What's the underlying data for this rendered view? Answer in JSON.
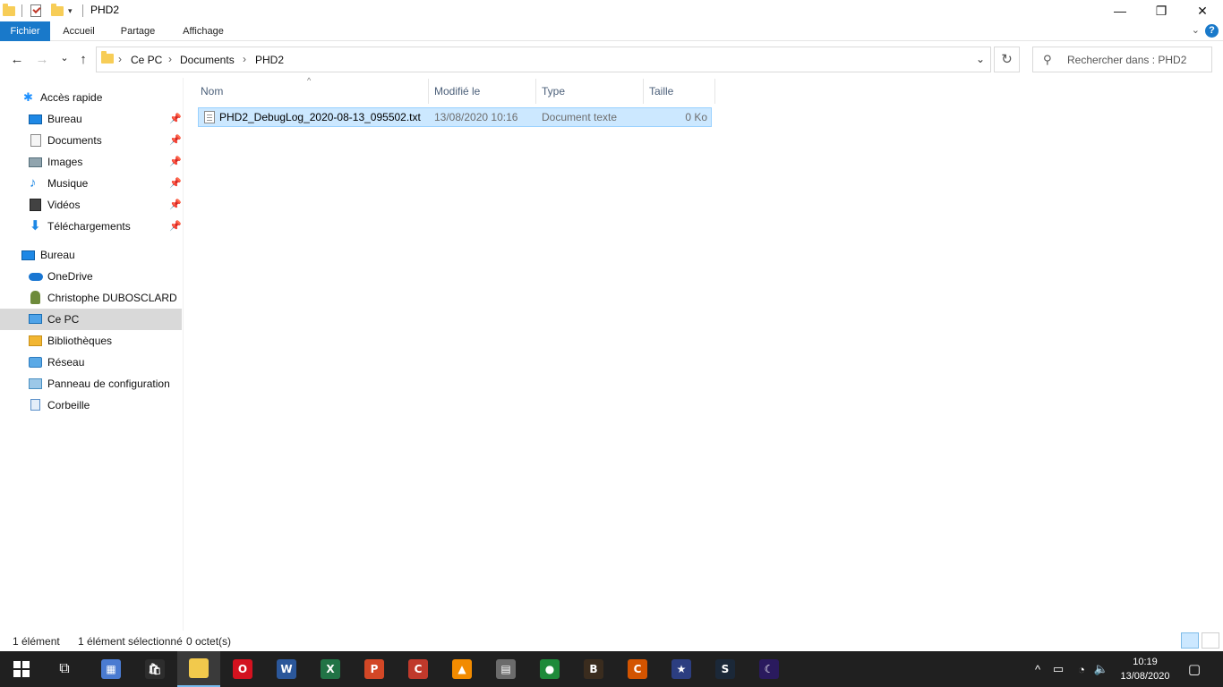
{
  "window": {
    "title": "PHD2",
    "minimize_glyph": "—",
    "maximize_glyph": "❐",
    "close_glyph": "✕"
  },
  "ribbon": {
    "tabs": [
      {
        "label": "Fichier"
      },
      {
        "label": "Accueil"
      },
      {
        "label": "Partage"
      },
      {
        "label": "Affichage"
      }
    ],
    "help_glyph": "?"
  },
  "nav": {
    "back_glyph": "←",
    "forward_glyph": "→",
    "recent_glyph": "⌄",
    "up_glyph": "↑",
    "breadcrumb": [
      "Ce PC",
      "Documents",
      "PHD2"
    ],
    "refresh_glyph": "↻",
    "search_placeholder": "Rechercher dans : PHD2"
  },
  "sidebar": {
    "quick_access": {
      "label": "Accès rapide",
      "icon": "star-icon",
      "color": "#1e90ff"
    },
    "pinned": [
      {
        "label": "Bureau",
        "icon": "desktop-icon",
        "color": "#1e88e5"
      },
      {
        "label": "Documents",
        "icon": "documents-icon",
        "color": "#9e9e9e"
      },
      {
        "label": "Images",
        "icon": "pictures-icon",
        "color": "#607d8b"
      },
      {
        "label": "Musique",
        "icon": "music-icon",
        "color": "#1e88e5"
      },
      {
        "label": "Vidéos",
        "icon": "videos-icon",
        "color": "#424242"
      },
      {
        "label": "Téléchargements",
        "icon": "download-icon",
        "color": "#1e88e5"
      }
    ],
    "tree": [
      {
        "label": "Bureau",
        "icon": "desktop-icon",
        "color": "#1e88e5"
      },
      {
        "label": "OneDrive",
        "icon": "cloud-icon",
        "color": "#1976d2"
      },
      {
        "label": "Christophe DUBOSCLARD",
        "icon": "user-icon",
        "color": "#6d8a3a"
      },
      {
        "label": "Ce PC",
        "icon": "computer-icon",
        "color": "#1e88e5",
        "selected": true
      },
      {
        "label": "Bibliothèques",
        "icon": "libraries-icon",
        "color": "#f2b632"
      },
      {
        "label": "Réseau",
        "icon": "network-icon",
        "color": "#1e88e5"
      },
      {
        "label": "Panneau de configuration",
        "icon": "control-panel-icon",
        "color": "#4a90c2"
      },
      {
        "label": "Corbeille",
        "icon": "recycle-bin-icon",
        "color": "#5a8fc9"
      }
    ]
  },
  "columns": [
    {
      "label": "Nom"
    },
    {
      "label": "Modifié le"
    },
    {
      "label": "Type"
    },
    {
      "label": "Taille"
    }
  ],
  "files": [
    {
      "name": "PHD2_DebugLog_2020-08-13_095502.txt",
      "modified": "13/08/2020 10:16",
      "type": "Document texte",
      "size": "0 Ko",
      "selected": true
    }
  ],
  "status": {
    "count": "1 élément",
    "selection": "1 élément sélectionné",
    "size": "0 octet(s)"
  },
  "taskbar": {
    "apps": [
      {
        "name": "calculator",
        "color": "#4a7bd1",
        "glyph": "▦"
      },
      {
        "name": "store",
        "color": "#2d2d2d",
        "glyph": "🛍"
      },
      {
        "name": "file-explorer",
        "color": "#f2c94c",
        "glyph": "",
        "active": true
      },
      {
        "name": "opera",
        "color": "#d3121f",
        "glyph": "O"
      },
      {
        "name": "word",
        "color": "#2b579a",
        "glyph": "W"
      },
      {
        "name": "excel",
        "color": "#217346",
        "glyph": "X"
      },
      {
        "name": "powerpoint",
        "color": "#d24726",
        "glyph": "P"
      },
      {
        "name": "ccleaner",
        "color": "#c0392b",
        "glyph": "C"
      },
      {
        "name": "vlc",
        "color": "#f28b00",
        "glyph": "▲"
      },
      {
        "name": "app-gray",
        "color": "#6b6b6b",
        "glyph": "▤"
      },
      {
        "name": "app-green",
        "color": "#1e8a3a",
        "glyph": "●"
      },
      {
        "name": "backyard-eos",
        "color": "#3a2c1e",
        "glyph": "B"
      },
      {
        "name": "cpwi",
        "color": "#d35400",
        "glyph": "C"
      },
      {
        "name": "app-stars",
        "color": "#2c3e80",
        "glyph": "★"
      },
      {
        "name": "steam",
        "color": "#1b2838",
        "glyph": "S"
      },
      {
        "name": "stellarium",
        "color": "#2a1a5e",
        "glyph": "☾"
      }
    ],
    "clock_time": "10:19",
    "clock_date": "13/08/2020"
  }
}
